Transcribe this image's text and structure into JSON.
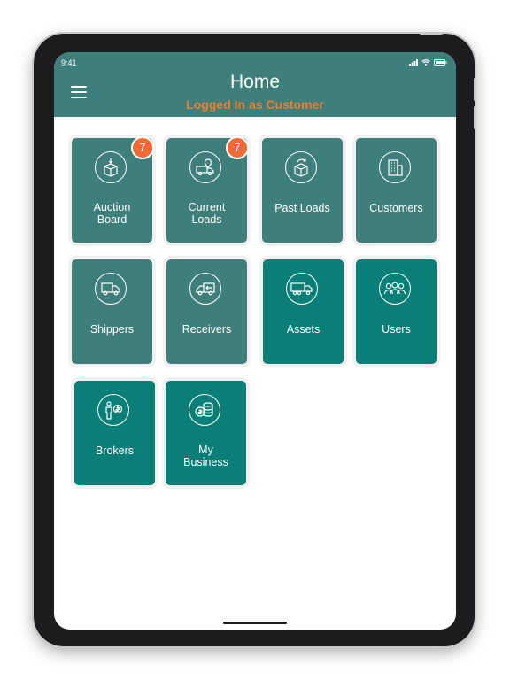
{
  "status_bar": {
    "time": "9:41",
    "icons": [
      "signal-icon",
      "wifi-icon",
      "battery-icon"
    ]
  },
  "header": {
    "title": "Home",
    "subtitle": "Logged In as Customer"
  },
  "colors": {
    "header": "#3f7f7b",
    "tile_muted": "#3f7f7b",
    "tile_bright": "#097f78",
    "accent": "#f07c2d",
    "badge": "#f06a35"
  },
  "tiles": [
    {
      "label": "Auction\nBoard",
      "icon": "box-download-icon",
      "badge": "7"
    },
    {
      "label": "Current\nLoads",
      "icon": "truck-map-pin-icon",
      "badge": "7"
    },
    {
      "label": "Past Loads",
      "icon": "box-history-icon"
    },
    {
      "label": "Customers",
      "icon": "building-icon"
    },
    {
      "label": "Shippers",
      "icon": "truck-icon"
    },
    {
      "label": "Receivers",
      "icon": "truck-arrow-icon"
    },
    {
      "label": "Assets",
      "icon": "semi-truck-icon"
    },
    {
      "label": "Users",
      "icon": "users-group-icon"
    },
    {
      "label": "Brokers",
      "icon": "person-coin-icon"
    },
    {
      "label": "My\nBusiness",
      "icon": "coins-stack-icon"
    }
  ]
}
